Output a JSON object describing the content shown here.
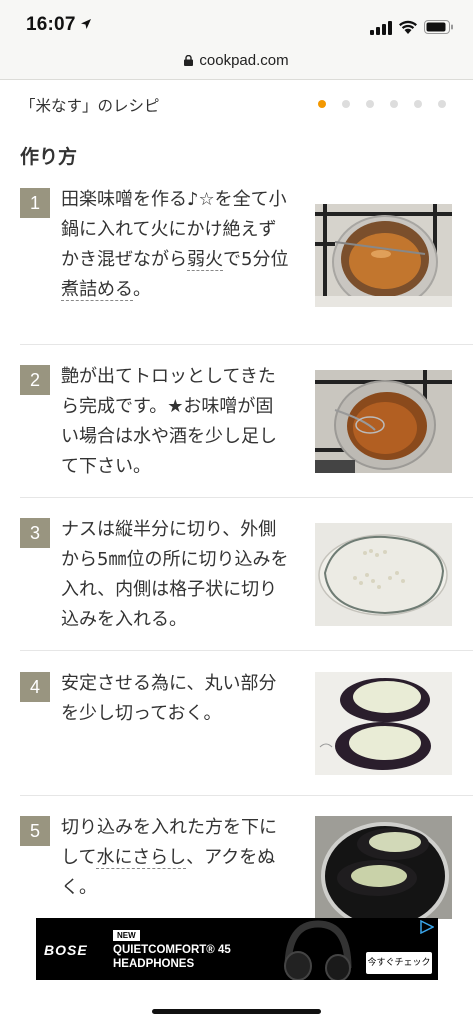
{
  "status_bar": {
    "time": "16:07"
  },
  "browser": {
    "url": "cookpad.com"
  },
  "header": {
    "recipe_title": "「米なす」のレシピ",
    "page_dots_total": 6,
    "page_dots_active": 1
  },
  "section_title": "作り方",
  "steps": [
    {
      "number": "1",
      "text_parts": [
        "田楽味噌を作る♪☆を全て小鍋に入れて火にかけ絶えずかき混ぜながら",
        "弱火",
        "で5分位",
        "煮詰める",
        "。"
      ],
      "photo": "pot-with-miso-sauce"
    },
    {
      "number": "2",
      "text": "艶が出てトロッとしてきたら完成です。★お味噌が固い場合は水や酒を少し足して下さい。",
      "photo": "whisking-miso-in-pot"
    },
    {
      "number": "3",
      "text": "ナスは縦半分に切り、外側から5㎜位の所に切り込みを入れ、内側は格子状に切り込みを入れる。",
      "photo": "scored-eggplant-half"
    },
    {
      "number": "4",
      "text": "安定させる為に、丸い部分を少し切っておく。",
      "photo": "two-eggplant-halves"
    },
    {
      "number": "5",
      "text_parts": [
        "切り込みを入れた方を下にして",
        "水にさらし",
        "、アクをぬく。"
      ],
      "photo": "eggplant-soaking-in-water"
    }
  ],
  "ad": {
    "brand": "BOSE",
    "badge": "NEW",
    "line1": "QUIETCOMFORT® 45",
    "line2": "HEADPHONES",
    "cta": "今すぐチェック"
  },
  "colors": {
    "accent": "#f39800",
    "step_number_bg": "#999580",
    "divider": "#e6e6e6"
  }
}
